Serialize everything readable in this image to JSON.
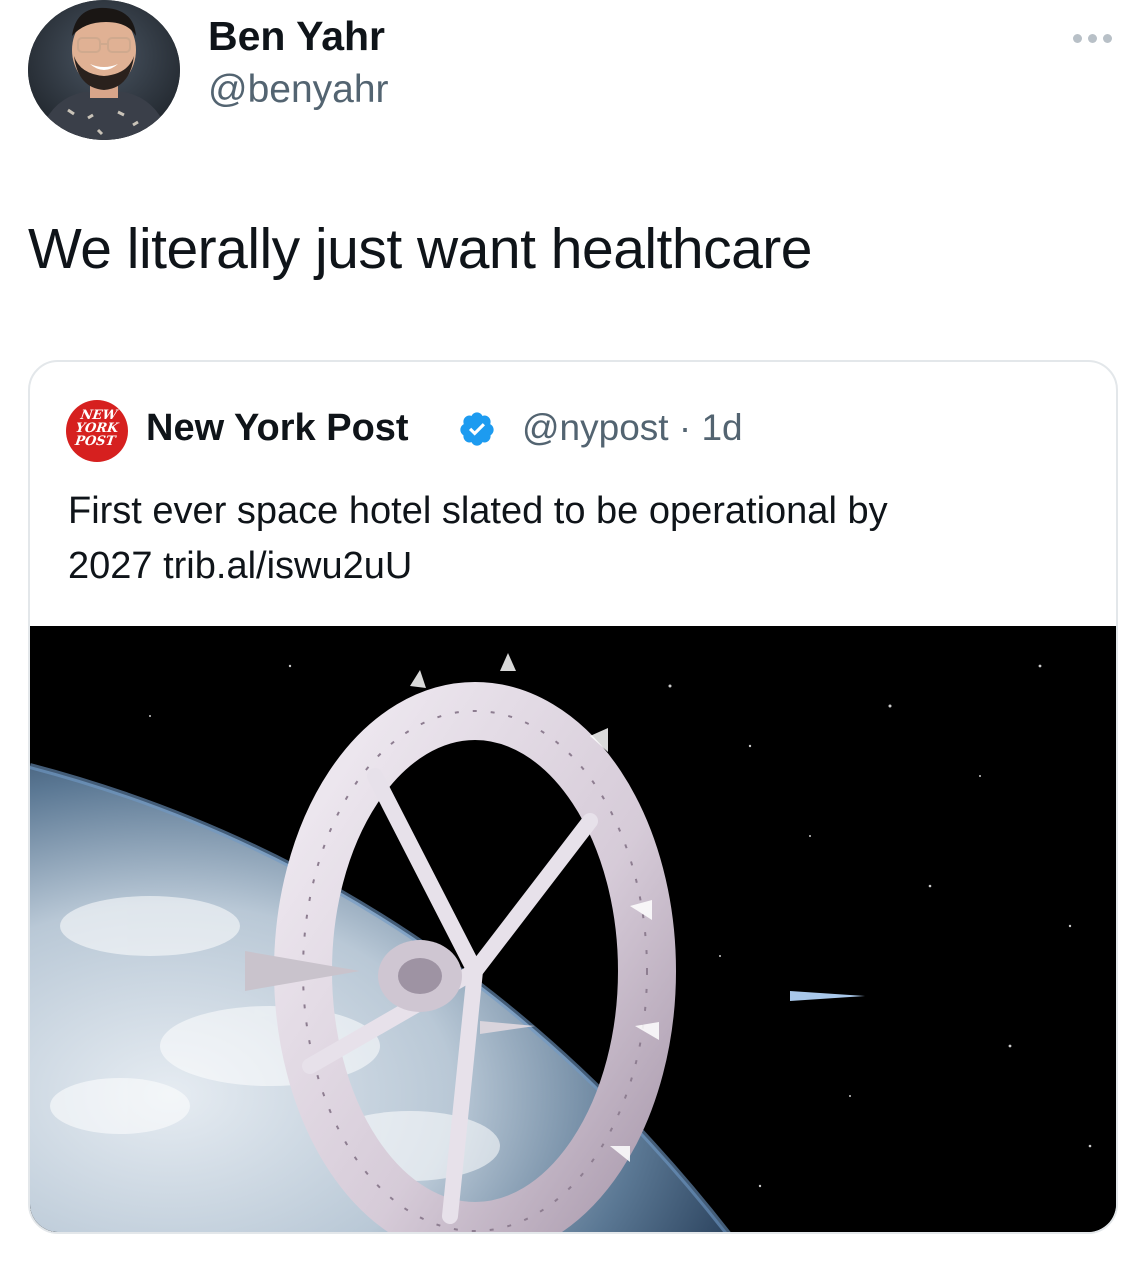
{
  "author": {
    "display_name": "Ben Yahr",
    "handle": "@benyahr"
  },
  "tweet": {
    "text": "We literally just want healthcare"
  },
  "quoted_tweet": {
    "display_name": "New York Post",
    "logo_text": [
      "NEW",
      "YORK",
      "POST"
    ],
    "handle_meta": "@nypost · 1d",
    "text_line1": "First ever space hotel slated to be operational by",
    "text_line2": "2027 trib.al/iswu2uU",
    "verified_color": "#1d9bf0",
    "brand_color": "#d6201f"
  },
  "icons": {
    "more": "more-horizontal-icon",
    "verified": "verified-badge-icon"
  }
}
